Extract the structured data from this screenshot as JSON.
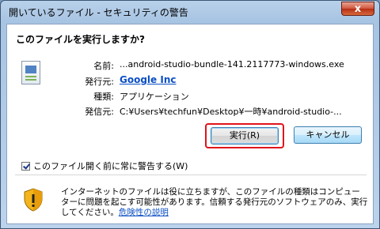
{
  "window": {
    "title": "開いているファイル - セキュリティの警告",
    "close_glyph": "x"
  },
  "question": "このファイルを実行しますか?",
  "details": {
    "name_label": "名前:",
    "name_value": "...android-studio-bundle-141.2117773-windows.exe",
    "publisher_label": "発行元:",
    "publisher_value": "Google Inc",
    "type_label": "種類:",
    "type_value": "アプリケーション",
    "from_label": "発信元:",
    "from_value": "C:¥Users¥techfun¥Desktop¥一時¥android-studio-..."
  },
  "buttons": {
    "run_label": "実行(R)",
    "cancel_label": "キャンセル"
  },
  "checkbox": {
    "label": "このファイル開く前に常に警告する(W)",
    "checked": true
  },
  "warning": {
    "text": "インターネットのファイルは役に立ちますが、このファイルの種類はコンピューターに問題を起こす可能性があります。信頼する発行元のソフトウェアのみ、実行してください。",
    "link": "危険性の説明"
  },
  "highlight_color": "#e0141b"
}
